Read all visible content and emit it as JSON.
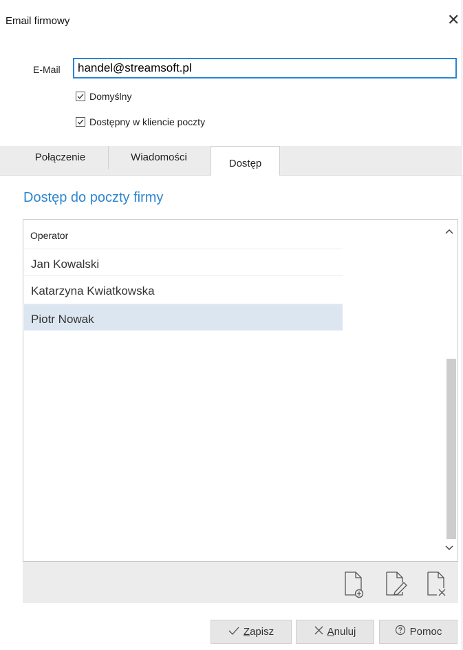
{
  "window": {
    "title": "Email firmowy",
    "close_glyph": "✕"
  },
  "email": {
    "label": "E-Mail",
    "value": "handel@streamsoft.pl"
  },
  "checkboxes": [
    {
      "label": "Domyślny",
      "checked": true
    },
    {
      "label": "Dostępny w kliencie poczty",
      "checked": true
    }
  ],
  "tabs": [
    {
      "label": "Połączenie",
      "active": false
    },
    {
      "label": "Wiadomości",
      "active": false
    },
    {
      "label": "Dostęp",
      "active": true
    }
  ],
  "section": {
    "title": "Dostęp do poczty firmy"
  },
  "grid": {
    "column_header": "Operator",
    "rows": [
      "Jan Kowalski",
      "Katarzyna Kwiatkowska",
      "Piotr Nowak"
    ],
    "selected_row": "Piotr Nowak"
  },
  "toolbar": {
    "icons": [
      "add-document-icon",
      "edit-document-icon",
      "delete-document-icon"
    ]
  },
  "buttons": {
    "save": {
      "icon": "check-icon",
      "underlined": "Z",
      "rest": "apisz"
    },
    "cancel": {
      "icon": "x-icon",
      "underlined": "A",
      "rest": "nuluj"
    },
    "help": {
      "icon": "help-circle-icon",
      "label": "Pomoc"
    }
  },
  "colors": {
    "accent": "#2e86cf",
    "selection": "#dce6f1",
    "input_border": "#2a84d2"
  }
}
